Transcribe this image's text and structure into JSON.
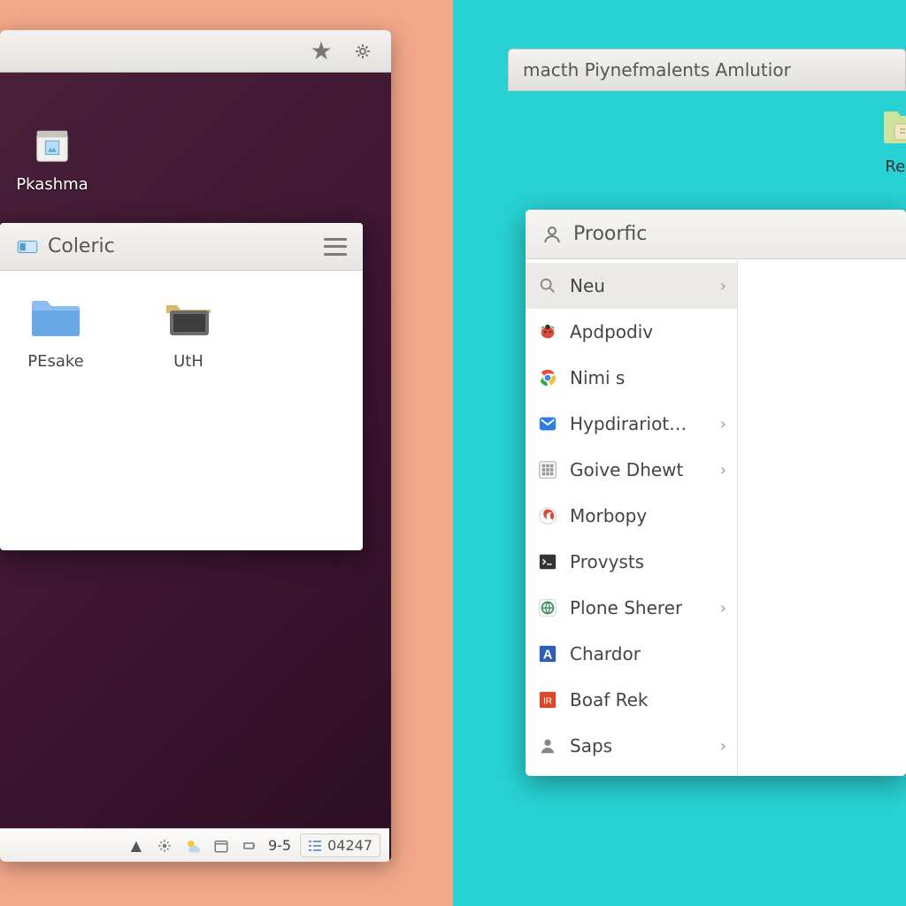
{
  "left": {
    "desktop_icons": {
      "plashma": "Pkashma"
    },
    "fm": {
      "title": "Coleric",
      "items": [
        "PEsake",
        "UtH"
      ]
    },
    "taskbar": {
      "time1": "9-5",
      "time2": "04247"
    }
  },
  "right": {
    "prefs_title": "macth Piynefmalents Amlutior",
    "desk_icon_label": "Rest",
    "menu": {
      "header": "Proorfic",
      "items": [
        {
          "label": "Neu",
          "icon": "search-icon",
          "sub": true
        },
        {
          "label": "Apdpodiv",
          "icon": "ladybug-icon",
          "sub": false
        },
        {
          "label": "Nimi s",
          "icon": "chrome-icon",
          "sub": false
        },
        {
          "label": "Hypdirariote...",
          "icon": "mail-icon",
          "sub": true
        },
        {
          "label": "Goive Dhewt",
          "icon": "grid-icon",
          "sub": true
        },
        {
          "label": "Morbopy",
          "icon": "swirl-icon",
          "sub": false
        },
        {
          "label": "Provysts",
          "icon": "terminal-icon",
          "sub": false
        },
        {
          "label": "Plone Sherer",
          "icon": "globe-icon",
          "sub": true
        },
        {
          "label": "Chardor",
          "icon": "letter-a-icon",
          "sub": false
        },
        {
          "label": "Boaf Rek",
          "icon": "red-box-icon",
          "sub": false
        },
        {
          "label": "Saps",
          "icon": "person-icon",
          "sub": true
        }
      ]
    }
  }
}
